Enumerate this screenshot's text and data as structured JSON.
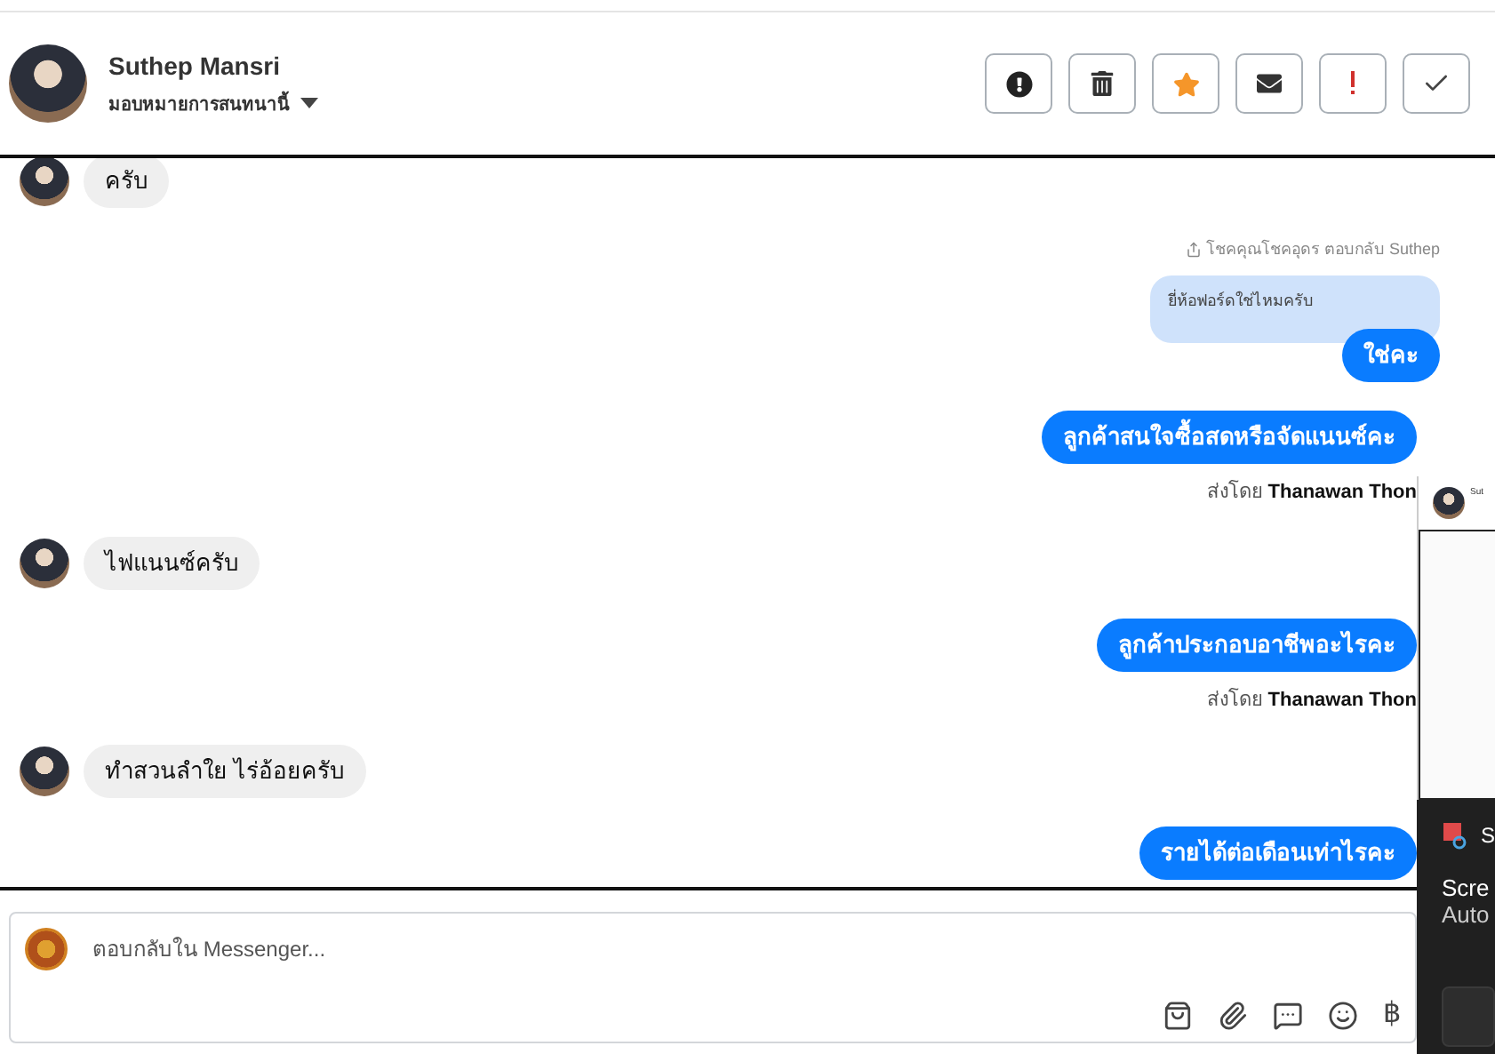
{
  "header": {
    "name": "Suthep Mansri",
    "subtitle": "มอบหมายการสนทนานี้",
    "actions": [
      {
        "kind": "alert"
      },
      {
        "kind": "trash"
      },
      {
        "kind": "star"
      },
      {
        "kind": "mail"
      },
      {
        "kind": "important"
      },
      {
        "kind": "done"
      }
    ]
  },
  "messages": [
    {
      "kind": "incoming",
      "text": "ครับ"
    },
    {
      "kind": "reply",
      "label": "โชคคุณโชคอุดร ตอบกลับ Suthep",
      "quoted": "ยี่ห้อฟอร์ดใช่ไหมครับ",
      "text": "ใช่คะ"
    },
    {
      "kind": "outgoing",
      "text": "ลูกค้าสนใจซื้อสดหรือจัดแนนซ์คะ"
    },
    {
      "kind": "sender",
      "prefix": "ส่งโดย",
      "name": "Thanawan Thon"
    },
    {
      "kind": "incoming",
      "text": "ไฟแนนซ์ครับ"
    },
    {
      "kind": "outgoing",
      "text": "ลูกค้าประกอบอาชีพอะไรคะ"
    },
    {
      "kind": "sender",
      "prefix": "ส่งโดย",
      "name": "Thanawan Thon"
    },
    {
      "kind": "incoming",
      "text": "ทำสวนลำใย  ไร่อ้อยครับ"
    },
    {
      "kind": "outgoing",
      "text": "รายได้ต่อเดือนเท่าไรคะ"
    }
  ],
  "composer": {
    "placeholder": "ตอบกลับใน Messenger...",
    "tools": [
      {
        "kind": "bag"
      },
      {
        "kind": "clip"
      },
      {
        "kind": "chat"
      },
      {
        "kind": "smile"
      },
      {
        "kind": "currency",
        "glyph": "฿"
      }
    ]
  },
  "notification": {
    "preview_title": "Sut",
    "app_initial": "S",
    "line_1": "Scre",
    "line_2": "Auto"
  }
}
